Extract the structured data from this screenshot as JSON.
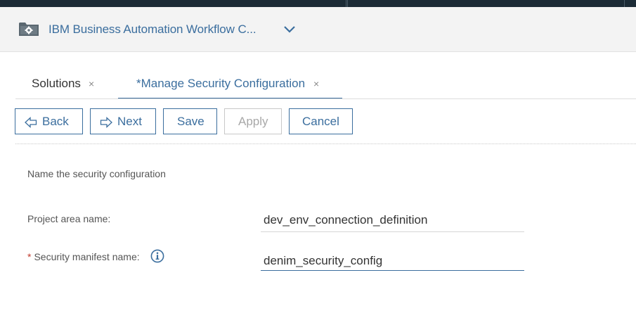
{
  "header": {
    "app_title": "IBM Business Automation Workflow C...",
    "app_icon": "folder-gear-icon",
    "dropdown_icon": "chevron-down-icon"
  },
  "tabs": [
    {
      "label": "Solutions",
      "close": "×",
      "active": false
    },
    {
      "label": "*Manage Security Configuration",
      "close": "×",
      "active": true
    }
  ],
  "toolbar": {
    "back_label": "Back",
    "next_label": "Next",
    "save_label": "Save",
    "apply_label": "Apply",
    "apply_enabled": false,
    "cancel_label": "Cancel"
  },
  "form": {
    "heading": "Name the security configuration",
    "project_area_label": "Project area name:",
    "project_area_value": "dev_env_connection_definition",
    "manifest_label": "Security manifest name:",
    "manifest_required": "*",
    "manifest_value": "denim_security_config",
    "info_icon": "info-icon"
  },
  "colors": {
    "accent": "#3b6e9e",
    "topbar": "#1c2b36",
    "header_bg": "#f3f3f3",
    "disabled": "#a8a8a8",
    "required": "#c0392b"
  }
}
